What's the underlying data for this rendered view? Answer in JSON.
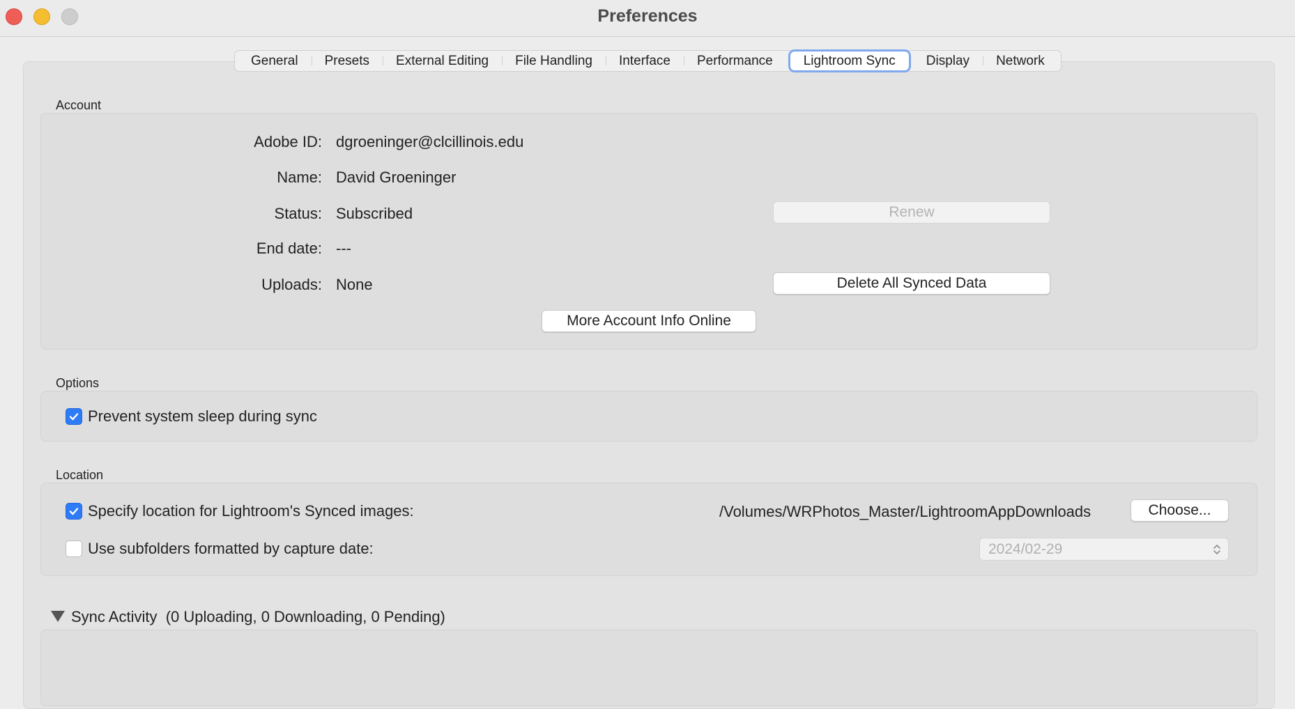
{
  "window": {
    "title": "Preferences"
  },
  "tabs": [
    {
      "label": "General",
      "active": false
    },
    {
      "label": "Presets",
      "active": false
    },
    {
      "label": "External Editing",
      "active": false
    },
    {
      "label": "File Handling",
      "active": false
    },
    {
      "label": "Interface",
      "active": false
    },
    {
      "label": "Performance",
      "active": false
    },
    {
      "label": "Lightroom Sync",
      "active": true
    },
    {
      "label": "Display",
      "active": false
    },
    {
      "label": "Network",
      "active": false
    }
  ],
  "account": {
    "section_label": "Account",
    "adobe_id_label": "Adobe ID:",
    "adobe_id_value": "dgroeninger@clcillinois.edu",
    "name_label": "Name:",
    "name_value": "David Groeninger",
    "status_label": "Status:",
    "status_value": "Subscribed",
    "end_date_label": "End date:",
    "end_date_value": "---",
    "uploads_label": "Uploads:",
    "uploads_value": "None",
    "renew_button": "Renew",
    "delete_button": "Delete All Synced Data",
    "more_info_button": "More Account Info Online"
  },
  "options": {
    "section_label": "Options",
    "prevent_sleep_label": "Prevent system sleep during sync",
    "prevent_sleep_checked": true
  },
  "location": {
    "section_label": "Location",
    "specify_label": "Specify location for Lightroom's Synced images:",
    "specify_checked": true,
    "path": "/Volumes/WRPhotos_Master/LightroomAppDownloads",
    "choose_button": "Choose...",
    "subfolders_label": "Use subfolders formatted by capture date:",
    "subfolders_checked": false,
    "date_format_value": "2024/02-29"
  },
  "sync_activity": {
    "label": "Sync Activity",
    "summary": "(0 Uploading, 0 Downloading, 0 Pending)"
  },
  "colors": {
    "accent": "#2e7bf6",
    "focus_ring": "#7fa8ee"
  }
}
